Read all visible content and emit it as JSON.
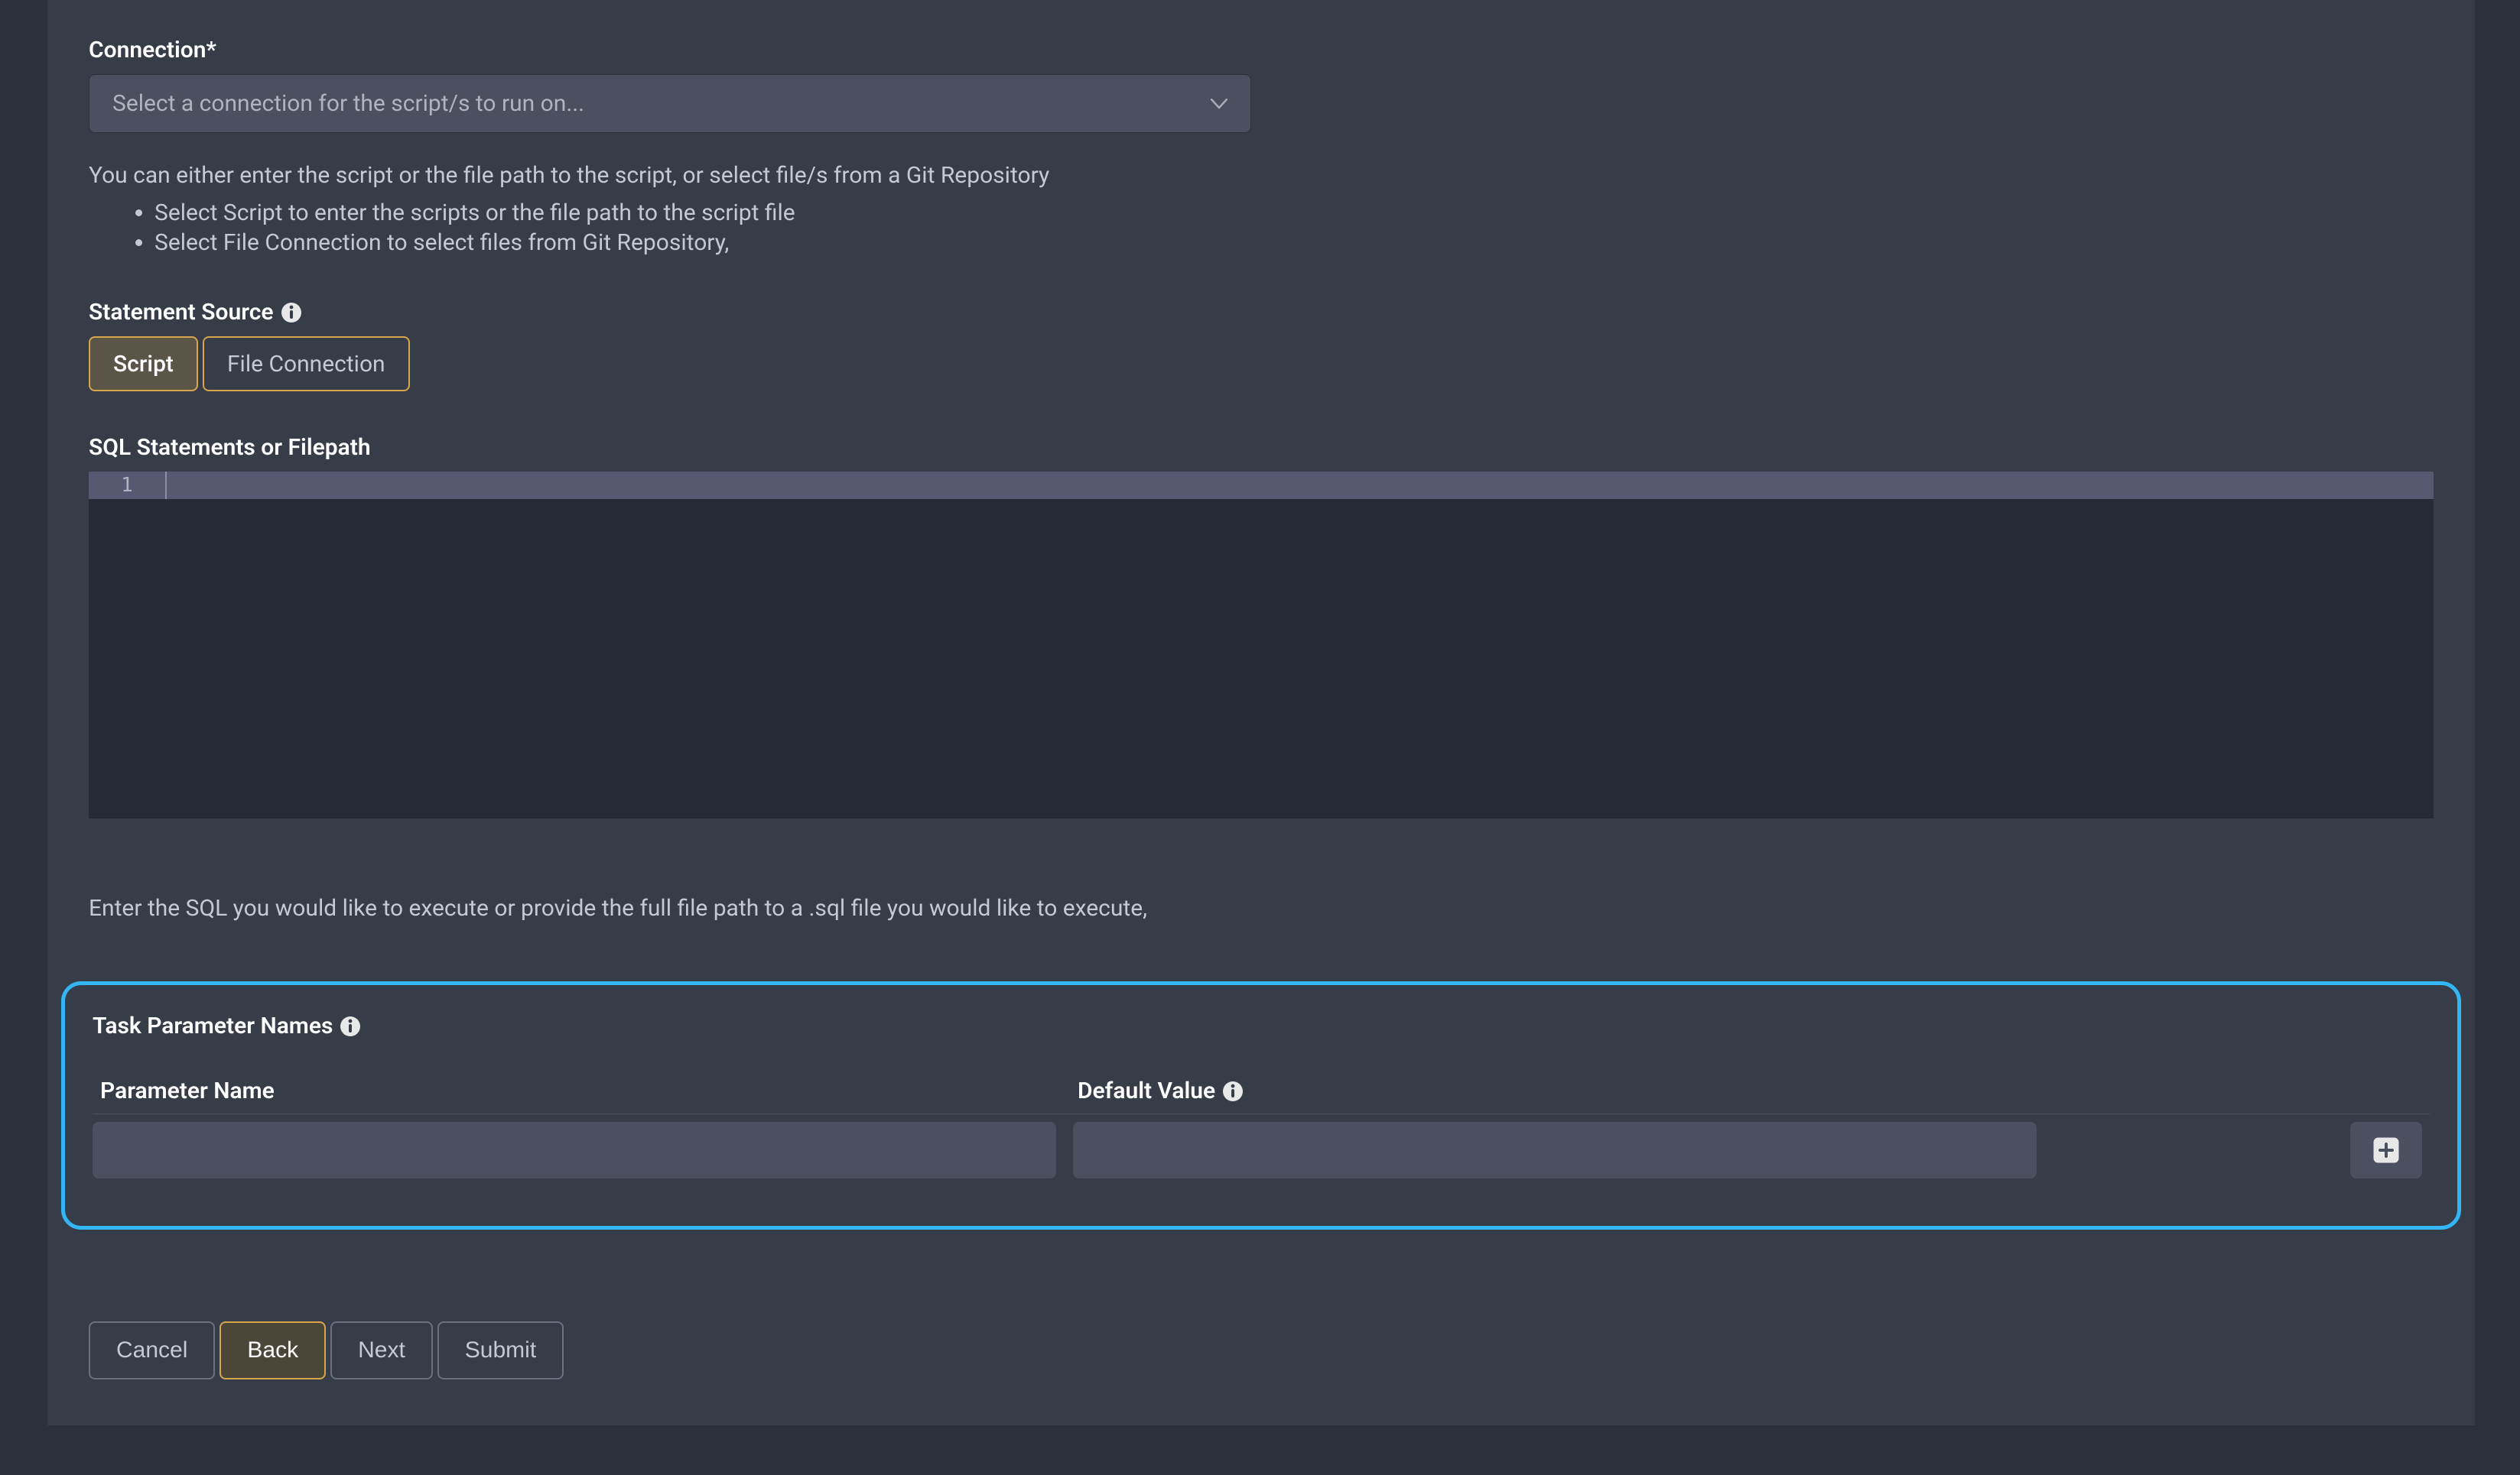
{
  "connection": {
    "label": "Connection*",
    "placeholder": "Select a connection for the script/s to run on..."
  },
  "helper_intro": "You can either enter the script or the file path to the script, or select file/s from a Git Repository",
  "helper_bullets": [
    "Select Script to enter the scripts or the file path to the script file",
    "Select File Connection to select files from Git Repository,"
  ],
  "statement_source": {
    "label": "Statement Source",
    "options": {
      "script": "Script",
      "file_connection": "File Connection"
    }
  },
  "sql_section": {
    "label": "SQL Statements or Filepath",
    "gutter_line": "1",
    "helper": "Enter the SQL you would like to execute or provide the full file path to a .sql file you would like to execute,"
  },
  "task_params": {
    "title": "Task Parameter Names",
    "col_name": "Parameter Name",
    "col_default": "Default Value",
    "rows": [
      {
        "name": "",
        "default_value": ""
      }
    ]
  },
  "footer": {
    "cancel": "Cancel",
    "back": "Back",
    "next": "Next",
    "submit": "Submit"
  }
}
